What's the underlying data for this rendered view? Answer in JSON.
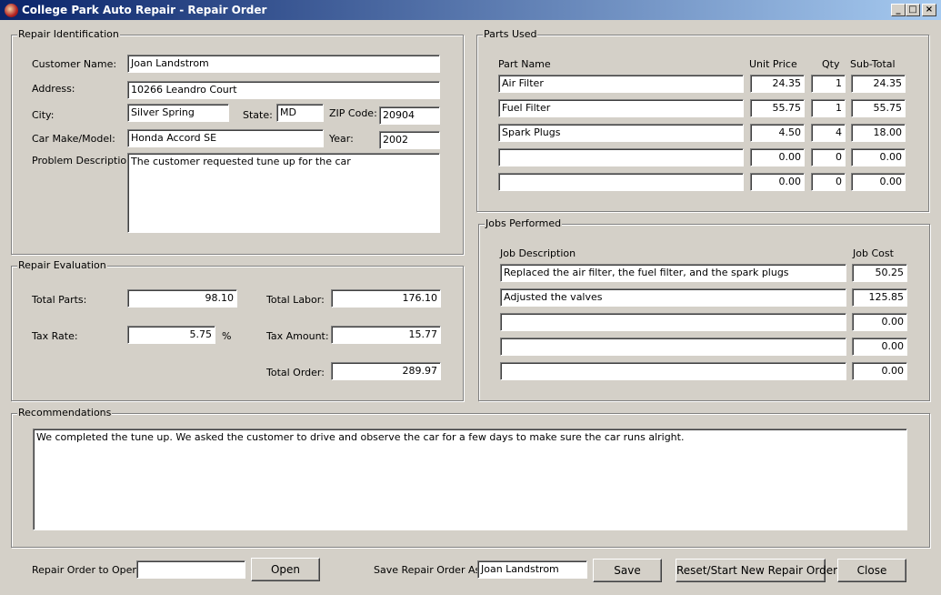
{
  "window": {
    "title": "College Park Auto Repair - Repair Order",
    "controls": {
      "minimize": "_",
      "maximize": "□",
      "close": "×"
    }
  },
  "repair_identification": {
    "legend": "Repair Identification",
    "customer_name_label": "Customer Name:",
    "customer_name": "Joan Landstrom",
    "address_label": "Address:",
    "address": "10266 Leandro Court",
    "city_label": "City:",
    "city": "Silver Spring",
    "state_label": "State:",
    "state": "MD",
    "zip_label": "ZIP Code:",
    "zip": "20904",
    "car_label": "Car Make/Model:",
    "car": "Honda Accord SE",
    "year_label": "Year:",
    "year": "2002",
    "problem_label": "Problem Description:",
    "problem": "The customer requested tune up for the car"
  },
  "repair_evaluation": {
    "legend": "Repair Evaluation",
    "total_parts_label": "Total Parts:",
    "total_parts": "98.10",
    "total_labor_label": "Total Labor:",
    "total_labor": "176.10",
    "tax_rate_label": "Tax Rate:",
    "tax_rate": "5.75",
    "percent": "%",
    "tax_amount_label": "Tax Amount:",
    "tax_amount": "15.77",
    "total_order_label": "Total Order:",
    "total_order": "289.97"
  },
  "parts_used": {
    "legend": "Parts Used",
    "headers": {
      "part_name": "Part Name",
      "unit_price": "Unit Price",
      "qty": "Qty",
      "sub_total": "Sub-Total"
    },
    "rows": [
      {
        "name": "Air Filter",
        "price": "24.35",
        "qty": "1",
        "subtotal": "24.35"
      },
      {
        "name": "Fuel Filter",
        "price": "55.75",
        "qty": "1",
        "subtotal": "55.75"
      },
      {
        "name": "Spark Plugs",
        "price": "4.50",
        "qty": "4",
        "subtotal": "18.00"
      },
      {
        "name": "",
        "price": "0.00",
        "qty": "0",
        "subtotal": "0.00"
      },
      {
        "name": "",
        "price": "0.00",
        "qty": "0",
        "subtotal": "0.00"
      }
    ]
  },
  "jobs_performed": {
    "legend": "Jobs Performed",
    "headers": {
      "description": "Job Description",
      "cost": "Job Cost"
    },
    "rows": [
      {
        "description": "Replaced the air filter, the fuel filter, and the spark plugs",
        "cost": "50.25"
      },
      {
        "description": "Adjusted the valves",
        "cost": "125.85"
      },
      {
        "description": "",
        "cost": "0.00"
      },
      {
        "description": "",
        "cost": "0.00"
      },
      {
        "description": "",
        "cost": "0.00"
      }
    ]
  },
  "recommendations": {
    "legend": "Recommendations",
    "text": "We completed the tune up. We asked the customer to drive and observe the car for a few days to make sure the car runs alright."
  },
  "footer": {
    "open_label": "Repair Order to Open:",
    "open_value": "",
    "open_button": "Open",
    "save_as_label": "Save Repair Order As:",
    "save_as_value": "Joan Landstrom",
    "save_button": "Save",
    "reset_button": "Reset/Start New Repair Order",
    "close_button": "Close"
  }
}
